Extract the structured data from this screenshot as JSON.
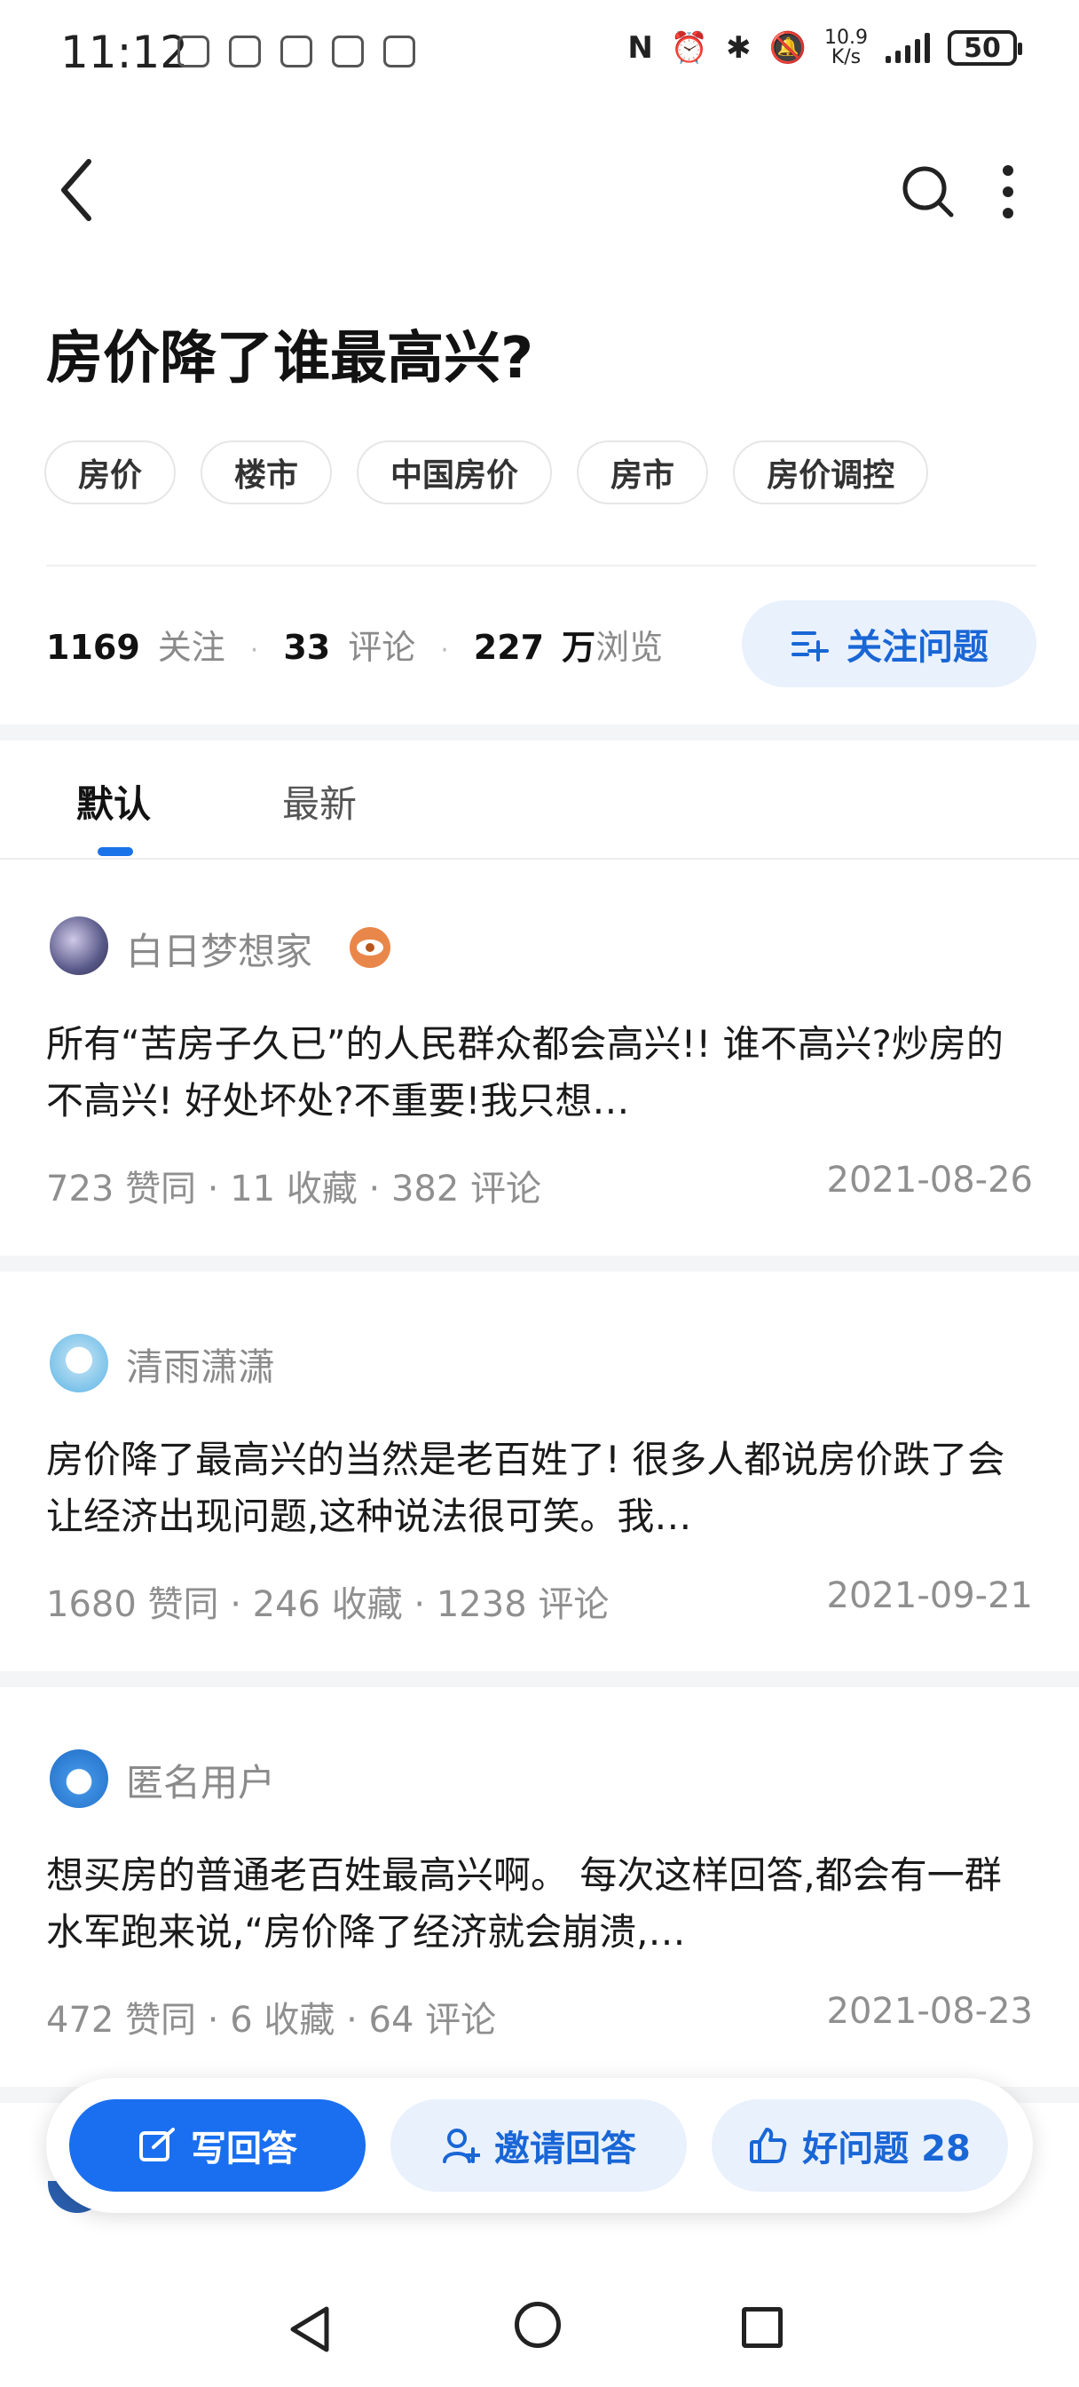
{
  "status_bar": {
    "time": "11:12",
    "speed_value": "10.9",
    "speed_unit": "K/s",
    "battery": "50"
  },
  "question": {
    "title": "房价降了谁最高兴?",
    "tags": [
      "房价",
      "楼市",
      "中国房价",
      "房市",
      "房价调控"
    ],
    "followers_count": "1169",
    "followers_label": "关注",
    "comments_count": "33",
    "comments_label": "评论",
    "views_count": "227",
    "views_unit": "万",
    "views_label": "浏览",
    "follow_button": "关注问题"
  },
  "tabs": [
    "默认",
    "最新"
  ],
  "answers": [
    {
      "author": "白日梦想家",
      "excerpt": "所有“苦房子久已”的人民群众都会高兴!! 谁不高兴?炒房的不高兴! 好处坏处?不重要!我只想…",
      "stats": "723 赞同 · 11 收藏 · 382 评论",
      "date": "2021-08-26"
    },
    {
      "author": "清雨潇潇",
      "excerpt": "房价降了最高兴的当然是老百姓了! 很多人都说房价跌了会让经济出现问题,这种说法很可笑。我…",
      "stats": "1680 赞同 · 246 收藏 · 1238 评论",
      "date": "2021-09-21"
    },
    {
      "author": "匿名用户",
      "excerpt": "想买房的普通老百姓最高兴啊。 每次这样回答,都会有一群水军跑来说,“房价降了经济就会崩溃,…",
      "stats": "472 赞同 · 6 收藏 · 64 评论",
      "date": "2021-08-23"
    }
  ],
  "actions": {
    "write": "写回答",
    "invite": "邀请回答",
    "good_question": "好问题 28"
  },
  "colors": {
    "accent": "#1a6ff0",
    "accent_light": "#e9f1fd",
    "muted_text": "#8a8a8a"
  }
}
